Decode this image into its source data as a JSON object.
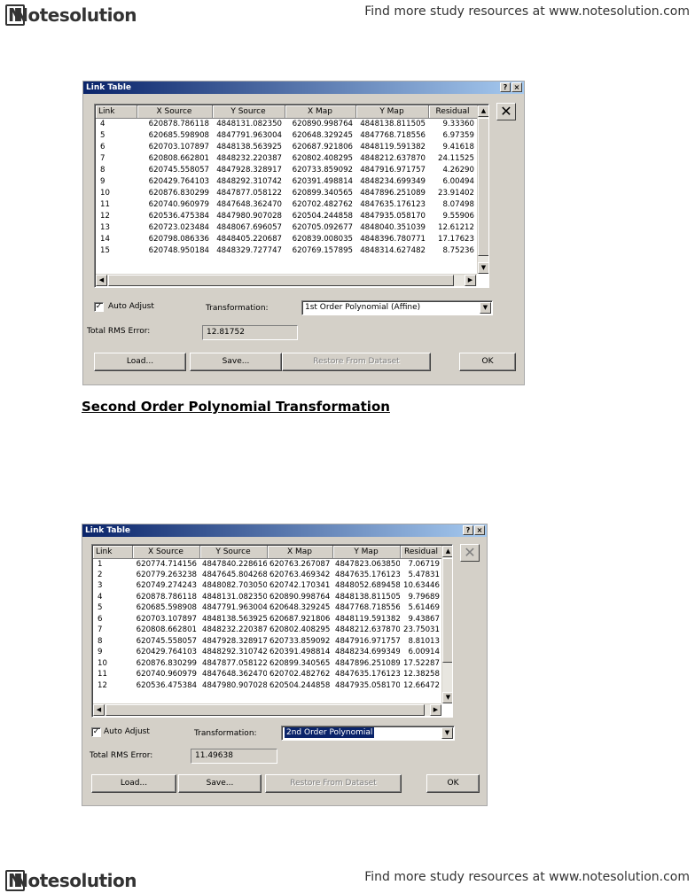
{
  "page": {
    "logo_text": "Notesolution",
    "tagline": "Find more study resources at www.notesolution.com",
    "section_title": "Second Order Polynomial Transformation"
  },
  "dialog1": {
    "title": "Link Table",
    "help_btn": "?",
    "close_btn": "×",
    "delete_link_symbol": "✕",
    "columns": [
      "Link",
      "X Source",
      "Y Source",
      "X Map",
      "Y Map",
      "Residual"
    ],
    "rows": [
      [
        "4",
        "620878.786118",
        "4848131.082350",
        "620890.998764",
        "4848138.811505",
        "9.33360"
      ],
      [
        "5",
        "620685.598908",
        "4847791.963004",
        "620648.329245",
        "4847768.718556",
        "6.97359"
      ],
      [
        "6",
        "620703.107897",
        "4848138.563925",
        "620687.921806",
        "4848119.591382",
        "9.41618"
      ],
      [
        "7",
        "620808.662801",
        "4848232.220387",
        "620802.408295",
        "4848212.637870",
        "24.11525"
      ],
      [
        "8",
        "620745.558057",
        "4847928.328917",
        "620733.859092",
        "4847916.971757",
        "4.26290"
      ],
      [
        "9",
        "620429.764103",
        "4848292.310742",
        "620391.498814",
        "4848234.699349",
        "6.00494"
      ],
      [
        "10",
        "620876.830299",
        "4847877.058122",
        "620899.340565",
        "4847896.251089",
        "23.91402"
      ],
      [
        "11",
        "620740.960979",
        "4847648.362470",
        "620702.482762",
        "4847635.176123",
        "8.07498"
      ],
      [
        "12",
        "620536.475384",
        "4847980.907028",
        "620504.244858",
        "4847935.058170",
        "9.55906"
      ],
      [
        "13",
        "620723.023484",
        "4848067.696057",
        "620705.092677",
        "4848040.351039",
        "12.61212"
      ],
      [
        "14",
        "620798.086336",
        "4848405.220687",
        "620839.008035",
        "4848396.780771",
        "17.17623"
      ],
      [
        "15",
        "620748.950184",
        "4848329.727747",
        "620769.157895",
        "4848314.627482",
        "8.75236"
      ]
    ],
    "auto_adjust_label": "Auto Adjust",
    "auto_adjust_checked": true,
    "transformation_label": "Transformation:",
    "transformation_value": "1st Order Polynomial (Affine)",
    "rms_label": "Total RMS Error:",
    "rms_value": "12.81752",
    "load_label": "Load...",
    "save_label": "Save...",
    "restore_label": "Restore From Dataset",
    "ok_label": "OK"
  },
  "dialog2": {
    "title": "Link Table",
    "help_btn": "?",
    "close_btn": "×",
    "delete_link_symbol": "✕",
    "columns": [
      "Link",
      "X Source",
      "Y Source",
      "X Map",
      "Y Map",
      "Residual"
    ],
    "rows": [
      [
        "1",
        "620774.714156",
        "4847840.228616",
        "620763.267087",
        "4847823.063850",
        "7.06719"
      ],
      [
        "2",
        "620779.263238",
        "4847645.804268",
        "620763.469342",
        "4847635.176123",
        "5.47831"
      ],
      [
        "3",
        "620749.274243",
        "4848082.703050",
        "620742.170341",
        "4848052.689458",
        "10.63446"
      ],
      [
        "4",
        "620878.786118",
        "4848131.082350",
        "620890.998764",
        "4848138.811505",
        "9.79689"
      ],
      [
        "5",
        "620685.598908",
        "4847791.963004",
        "620648.329245",
        "4847768.718556",
        "5.61469"
      ],
      [
        "6",
        "620703.107897",
        "4848138.563925",
        "620687.921806",
        "4848119.591382",
        "9.43867"
      ],
      [
        "7",
        "620808.662801",
        "4848232.220387",
        "620802.408295",
        "4848212.637870",
        "23.75031"
      ],
      [
        "8",
        "620745.558057",
        "4847928.328917",
        "620733.859092",
        "4847916.971757",
        "8.81013"
      ],
      [
        "9",
        "620429.764103",
        "4848292.310742",
        "620391.498814",
        "4848234.699349",
        "6.00914"
      ],
      [
        "10",
        "620876.830299",
        "4847877.058122",
        "620899.340565",
        "4847896.251089",
        "17.52287"
      ],
      [
        "11",
        "620740.960979",
        "4847648.362470",
        "620702.482762",
        "4847635.176123",
        "12.38258"
      ],
      [
        "12",
        "620536.475384",
        "4847980.907028",
        "620504.244858",
        "4847935.058170",
        "12.66472"
      ]
    ],
    "auto_adjust_label": "Auto Adjust",
    "auto_adjust_checked": true,
    "transformation_label": "Transformation:",
    "transformation_value": "2nd Order Polynomial",
    "rms_label": "Total RMS Error:",
    "rms_value": "11.49638",
    "load_label": "Load...",
    "save_label": "Save...",
    "restore_label": "Restore From Dataset",
    "ok_label": "OK"
  }
}
